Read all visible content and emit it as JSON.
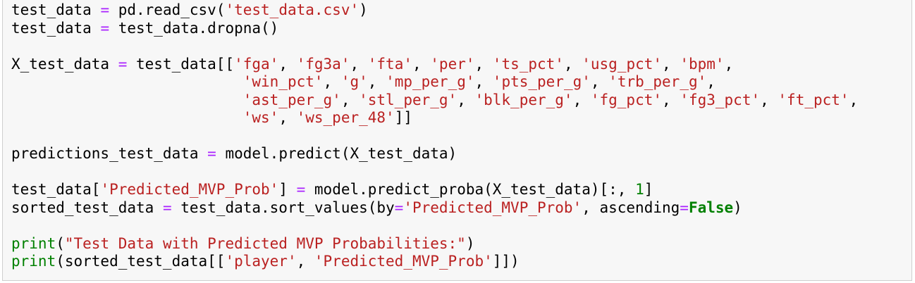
{
  "editor": {
    "language": "python",
    "lines": [
      [
        {
          "t": "test_data ",
          "c": "t"
        },
        {
          "t": "=",
          "c": "o"
        },
        {
          "t": " pd.read_csv(",
          "c": "t"
        },
        {
          "t": "'test_data.csv'",
          "c": "s"
        },
        {
          "t": ")",
          "c": "t"
        }
      ],
      [
        {
          "t": "test_data ",
          "c": "t"
        },
        {
          "t": "=",
          "c": "o"
        },
        {
          "t": " test_data.dropna()",
          "c": "t"
        }
      ],
      [],
      [
        {
          "t": "X_test_data ",
          "c": "t"
        },
        {
          "t": "=",
          "c": "o"
        },
        {
          "t": " test_data[[",
          "c": "t"
        },
        {
          "t": "'fga'",
          "c": "s"
        },
        {
          "t": ", ",
          "c": "t"
        },
        {
          "t": "'fg3a'",
          "c": "s"
        },
        {
          "t": ", ",
          "c": "t"
        },
        {
          "t": "'fta'",
          "c": "s"
        },
        {
          "t": ", ",
          "c": "t"
        },
        {
          "t": "'per'",
          "c": "s"
        },
        {
          "t": ", ",
          "c": "t"
        },
        {
          "t": "'ts_pct'",
          "c": "s"
        },
        {
          "t": ", ",
          "c": "t"
        },
        {
          "t": "'usg_pct'",
          "c": "s"
        },
        {
          "t": ", ",
          "c": "t"
        },
        {
          "t": "'bpm'",
          "c": "s"
        },
        {
          "t": ",",
          "c": "t"
        }
      ],
      [
        {
          "t": "                          ",
          "c": "t"
        },
        {
          "t": "'win_pct'",
          "c": "s"
        },
        {
          "t": ", ",
          "c": "t"
        },
        {
          "t": "'g'",
          "c": "s"
        },
        {
          "t": ", ",
          "c": "t"
        },
        {
          "t": "'mp_per_g'",
          "c": "s"
        },
        {
          "t": ", ",
          "c": "t"
        },
        {
          "t": "'pts_per_g'",
          "c": "s"
        },
        {
          "t": ", ",
          "c": "t"
        },
        {
          "t": "'trb_per_g'",
          "c": "s"
        },
        {
          "t": ",",
          "c": "t"
        }
      ],
      [
        {
          "t": "                          ",
          "c": "t"
        },
        {
          "t": "'ast_per_g'",
          "c": "s"
        },
        {
          "t": ", ",
          "c": "t"
        },
        {
          "t": "'stl_per_g'",
          "c": "s"
        },
        {
          "t": ", ",
          "c": "t"
        },
        {
          "t": "'blk_per_g'",
          "c": "s"
        },
        {
          "t": ", ",
          "c": "t"
        },
        {
          "t": "'fg_pct'",
          "c": "s"
        },
        {
          "t": ", ",
          "c": "t"
        },
        {
          "t": "'fg3_pct'",
          "c": "s"
        },
        {
          "t": ", ",
          "c": "t"
        },
        {
          "t": "'ft_pct'",
          "c": "s"
        },
        {
          "t": ",",
          "c": "t"
        }
      ],
      [
        {
          "t": "                          ",
          "c": "t"
        },
        {
          "t": "'ws'",
          "c": "s"
        },
        {
          "t": ", ",
          "c": "t"
        },
        {
          "t": "'ws_per_48'",
          "c": "s"
        },
        {
          "t": "]]",
          "c": "t"
        }
      ],
      [],
      [
        {
          "t": "predictions_test_data ",
          "c": "t"
        },
        {
          "t": "=",
          "c": "o"
        },
        {
          "t": " model.predict(X_test_data)",
          "c": "t"
        }
      ],
      [],
      [
        {
          "t": "test_data[",
          "c": "t"
        },
        {
          "t": "'Predicted_MVP_Prob'",
          "c": "s"
        },
        {
          "t": "] ",
          "c": "t"
        },
        {
          "t": "=",
          "c": "o"
        },
        {
          "t": " model.predict_proba(X_test_data)[:, ",
          "c": "t"
        },
        {
          "t": "1",
          "c": "k"
        },
        {
          "t": "]",
          "c": "t"
        }
      ],
      [
        {
          "t": "sorted_test_data ",
          "c": "t"
        },
        {
          "t": "=",
          "c": "o"
        },
        {
          "t": " test_data.sort_values(by",
          "c": "t"
        },
        {
          "t": "=",
          "c": "o"
        },
        {
          "t": "'Predicted_MVP_Prob'",
          "c": "s"
        },
        {
          "t": ", ascending",
          "c": "t"
        },
        {
          "t": "=",
          "c": "o"
        },
        {
          "t": "False",
          "c": "kb"
        },
        {
          "t": ")",
          "c": "t"
        }
      ],
      [],
      [
        {
          "t": "print",
          "c": "k"
        },
        {
          "t": "(",
          "c": "t"
        },
        {
          "t": "\"Test Data with Predicted MVP Probabilities:\"",
          "c": "s"
        },
        {
          "t": ")",
          "c": "t"
        }
      ],
      [
        {
          "t": "print",
          "c": "k"
        },
        {
          "t": "(sorted_test_data[[",
          "c": "t"
        },
        {
          "t": "'player'",
          "c": "s"
        },
        {
          "t": ", ",
          "c": "t"
        },
        {
          "t": "'Predicted_MVP_Prob'",
          "c": "s"
        },
        {
          "t": "]])",
          "c": "t"
        }
      ]
    ]
  }
}
